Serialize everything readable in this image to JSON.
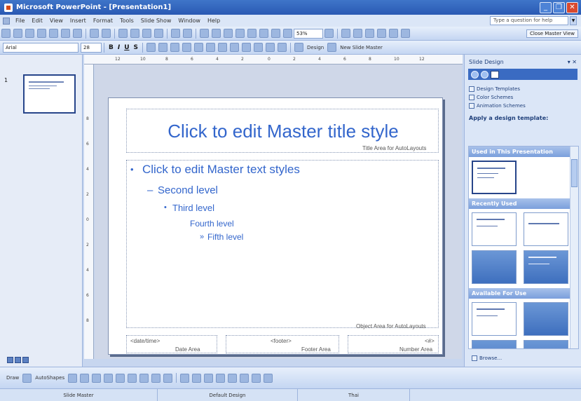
{
  "window": {
    "title": "Microsoft PowerPoint - [Presentation1]"
  },
  "menu": {
    "items": [
      "File",
      "Edit",
      "View",
      "Insert",
      "Format",
      "Tools",
      "Slide Show",
      "Window",
      "Help"
    ],
    "help_placeholder": "Type a question for help"
  },
  "toolbar": {
    "zoom": "53%",
    "font": "Arial",
    "font_size": "28",
    "bold": "B",
    "italic": "I",
    "underline": "U",
    "shadow": "S",
    "design_label": "Design",
    "new_slide_master": "New Slide Master",
    "close_master_view": "Close Master View"
  },
  "thumbnails": {
    "slide_number": "1"
  },
  "ruler": {
    "h_ticks": [
      "12",
      "10",
      "8",
      "6",
      "4",
      "2",
      "0",
      "2",
      "4",
      "6",
      "8",
      "10",
      "12"
    ],
    "v_ticks": [
      "8",
      "6",
      "4",
      "2",
      "0",
      "2",
      "4",
      "6",
      "8"
    ]
  },
  "slide": {
    "title": "Click to edit Master title style",
    "title_area_label": "Title Area for AutoLayouts",
    "level1": "Click to edit Master text styles",
    "level2": "Second level",
    "level3": "Third level",
    "level4": "Fourth level",
    "level5": "Fifth level",
    "object_area_label": "Object Area for AutoLayouts",
    "datetime_placeholder": "<date/time>",
    "date_area_label": "Date Area",
    "footer_placeholder": "<footer>",
    "footer_area_label": "Footer Area",
    "number_placeholder": "<#>",
    "number_area_label": "Number Area"
  },
  "taskpane": {
    "title": "Slide Design",
    "links": [
      "Design Templates",
      "Color Schemes",
      "Animation Schemes"
    ],
    "apply_heading": "Apply a design template:",
    "section_used": "Used in This Presentation",
    "section_recent": "Recently Used",
    "section_available": "Available For Use",
    "browse": "Browse..."
  },
  "draw_toolbar": {
    "draw_label": "Draw",
    "autoshapes_label": "AutoShapes"
  },
  "status": {
    "view": "Slide Master",
    "design": "Default Design",
    "language": "Thai"
  },
  "colors": {
    "title_bar": "#2a59b3",
    "slide_text": "#3366cc",
    "task_pane": "#dbe6f7"
  }
}
